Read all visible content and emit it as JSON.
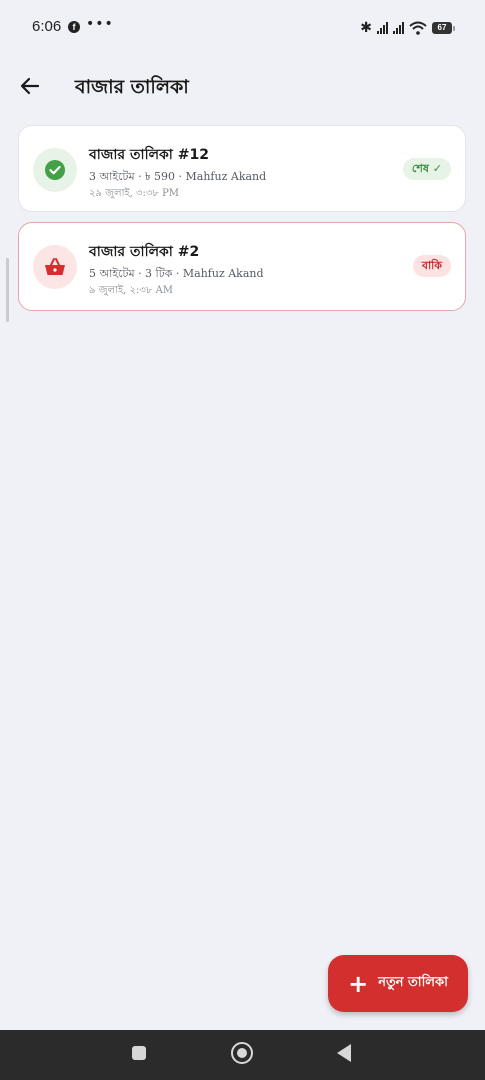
{
  "status_bar": {
    "time": "6:06",
    "battery": "67",
    "icons": [
      "facebook-icon",
      "more-dots-icon",
      "bluetooth-icon",
      "signal-icon",
      "signal-icon",
      "wifi-icon",
      "battery-icon"
    ]
  },
  "header": {
    "title": "বাজার তালিকা",
    "back_icon": "arrow-left-icon"
  },
  "lists": [
    {
      "title": "বাজার তালিকা #12",
      "meta": "3 আইটেম · ৳ 590 · Mahfuz Akand",
      "date": "২৯ জুলাই, ৩:৩৮ PM",
      "status": "শেষ ✓",
      "icon": "check-circle-icon",
      "state": "done"
    },
    {
      "title": "বাজার তালিকা #2",
      "meta": "5 আইটেম · 3 টিক · Mahfuz Akand",
      "date": "৯ জুলাই, ২:৩৮ AM",
      "status": "বাকি",
      "icon": "shopping-basket-icon",
      "state": "pending"
    }
  ],
  "fab": {
    "label": "নতুন তালিকা",
    "icon": "plus-icon"
  },
  "nav_bar": {
    "icons": [
      "recents-square-icon",
      "home-circle-icon",
      "back-triangle-icon"
    ]
  },
  "colors": {
    "background": "#f0f1f6",
    "accent_red": "#d32f2f",
    "done_green": "#43a047",
    "pending_border": "#e8a6a8"
  }
}
